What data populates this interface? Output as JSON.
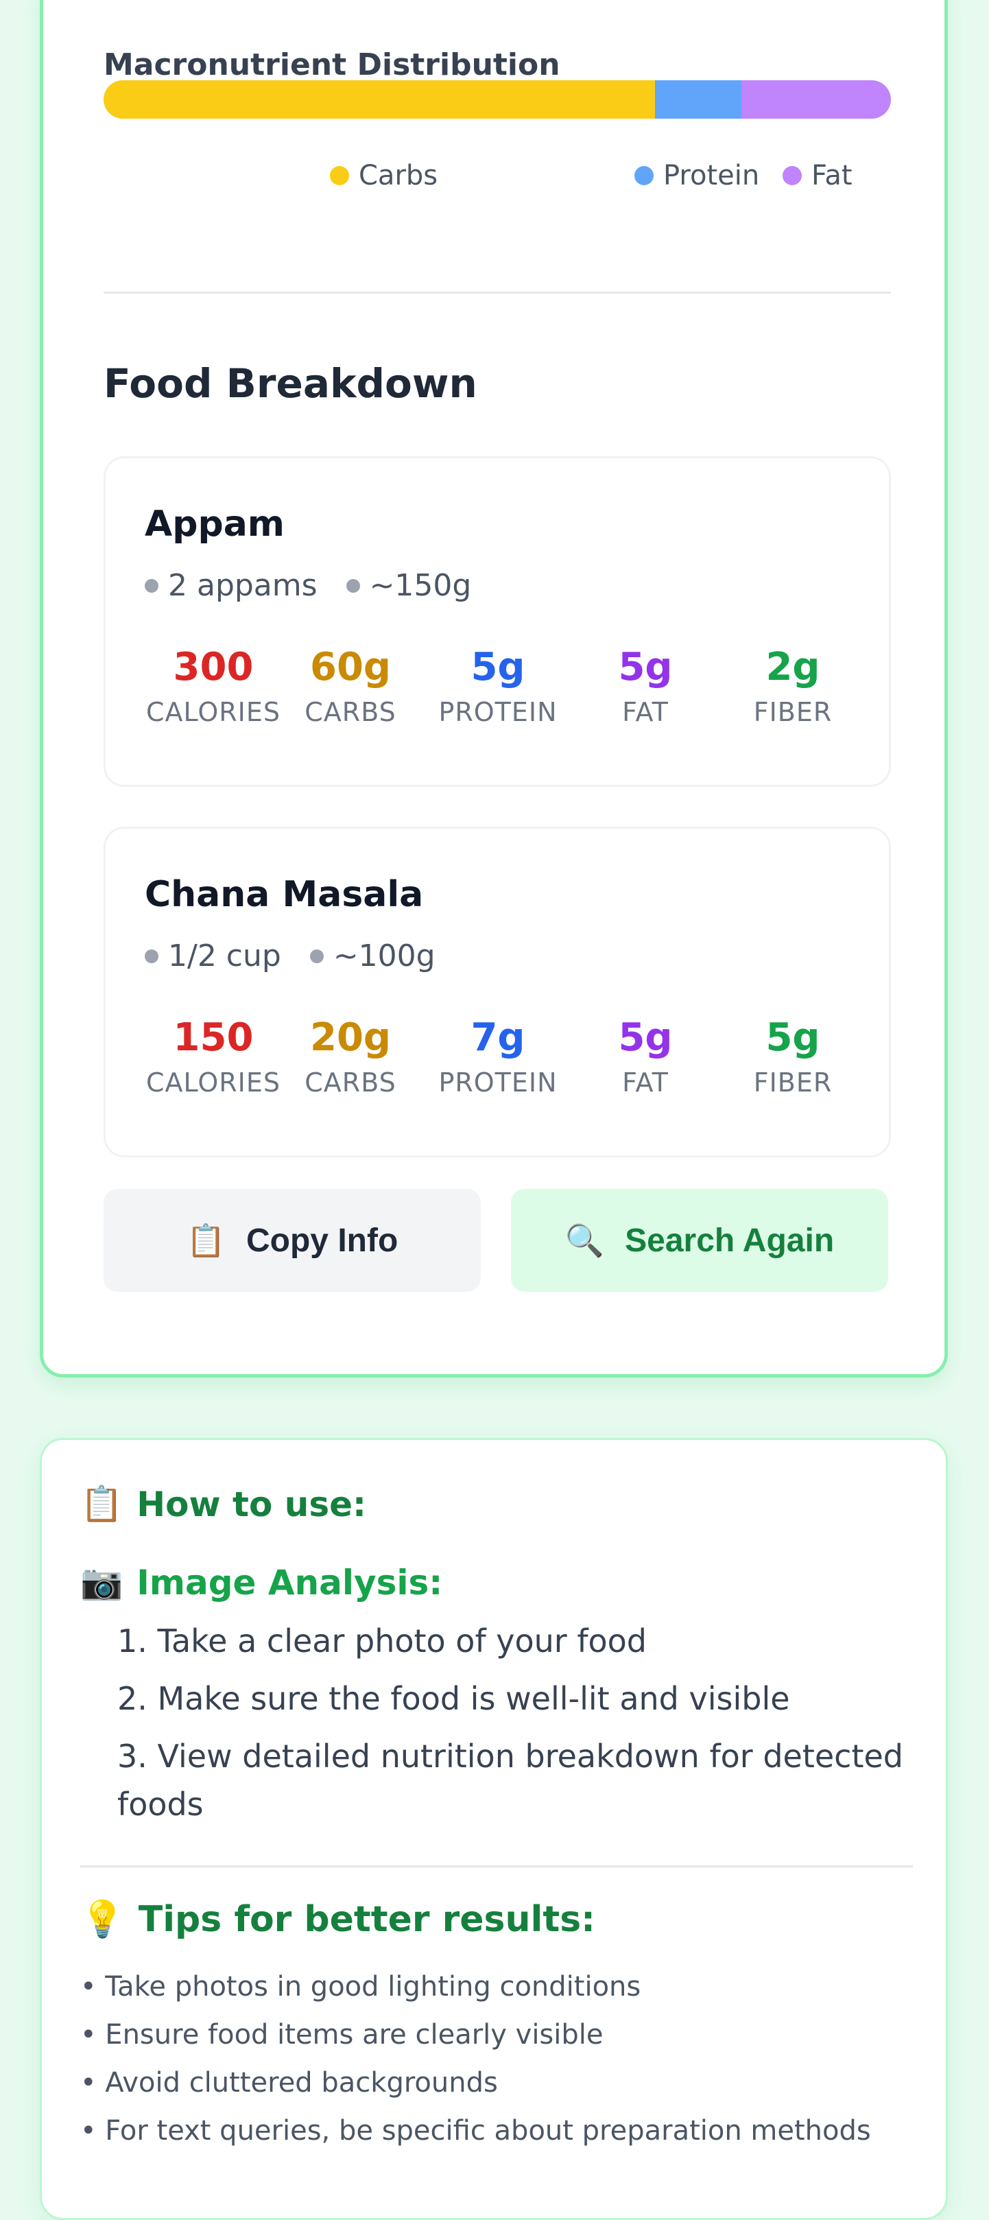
{
  "macro": {
    "title": "Macronutrient Distribution",
    "segments": [
      {
        "name": "Carbs",
        "percent": 70,
        "color": "#facc15"
      },
      {
        "name": "Protein",
        "percent": 11,
        "color": "#60a5fa"
      },
      {
        "name": "Fat",
        "percent": 19,
        "color": "#c084fc"
      }
    ]
  },
  "breakdown": {
    "title": "Food Breakdown",
    "foods": [
      {
        "name": "Appam",
        "portion": "2 appams",
        "weight": "~150g",
        "stats": {
          "calories": "300",
          "carbs": "60g",
          "protein": "5g",
          "fat": "5g",
          "fiber": "2g"
        }
      },
      {
        "name": "Chana Masala",
        "portion": "1/2 cup",
        "weight": "~100g",
        "stats": {
          "calories": "150",
          "carbs": "20g",
          "protein": "7g",
          "fat": "5g",
          "fiber": "5g"
        }
      }
    ],
    "labels": {
      "calories": "CALORIES",
      "carbs": "CARBS",
      "protein": "PROTEIN",
      "fat": "FAT",
      "fiber": "FIBER"
    }
  },
  "actions": {
    "copy_label": "Copy Info",
    "copy_icon": "📋",
    "search_label": "Search Again",
    "search_icon": "🔍"
  },
  "help": {
    "title": "How to use:",
    "title_icon": "📋",
    "image_title": "Image Analysis:",
    "image_icon": "📷",
    "steps": [
      "1. Take a clear photo of your food",
      "2. Make sure the food is well-lit and visible",
      "3. View detailed nutrition breakdown for detected foods"
    ],
    "tips_title": "Tips for better results:",
    "tips_icon": "💡",
    "tips": [
      "• Take photos in good lighting conditions",
      "• Ensure food items are clearly visible",
      "• Avoid cluttered backgrounds",
      "• For text queries, be specific about preparation methods"
    ]
  },
  "colors": {
    "calories": "#dc2626",
    "carbs": "#ca8a04",
    "protein": "#2563eb",
    "fat": "#9333ea",
    "fiber": "#16a34a",
    "heading_green": "#15803d"
  }
}
